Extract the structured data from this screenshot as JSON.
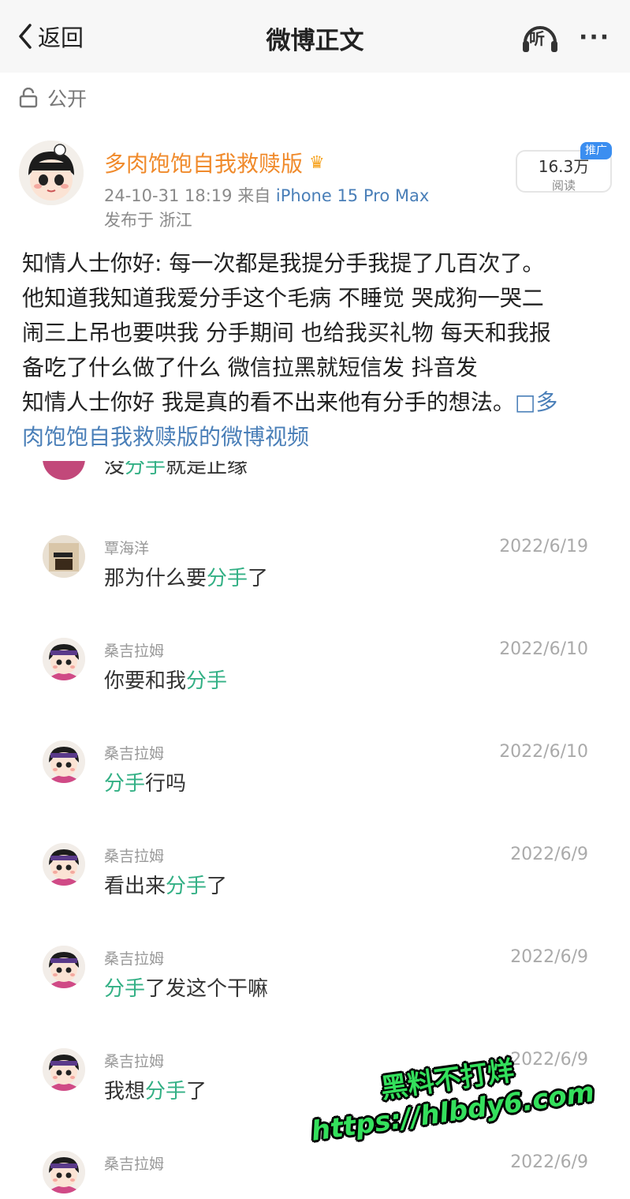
{
  "header": {
    "back_label": "返回",
    "title": "微博正文",
    "listen_label": "听",
    "more_label": "···"
  },
  "visibility": {
    "label": "公开"
  },
  "post": {
    "author": "多肉饱饱自我救赎版",
    "date": "24-10-31 18:19",
    "source_prefix": "来自",
    "device": "iPhone 15 Pro Max",
    "location": "发布于 浙江",
    "read_count": "16.3万",
    "read_label": "阅读",
    "promo_badge": "推广",
    "lines": [
      "知情人士你好: 每一次都是我提分手我提了几百次了。",
      "他知道我知道我爱分手这个毛病 不睡觉 哭成狗一哭二",
      "闹三上吊也要哄我 分手期间 也给我买礼物 每天和我报",
      "备吃了什么做了什么 微信拉黑就短信发 抖音发"
    ],
    "last_line": "知情人士你好 我是真的看不出来他有分手的想法。",
    "video_link_part1": "□多",
    "video_link_part2": "肉饱饱自我救赎版的微博视频"
  },
  "screenshot": {
    "partial_before": "没",
    "partial_keyword": "分手",
    "partial_after": "就是正缘",
    "comments": [
      {
        "name": "覃海洋",
        "date": "2022/6/19",
        "before": "那为什么要",
        "keyword": "分手",
        "after": "了"
      },
      {
        "name": "桑吉拉姆",
        "date": "2022/6/10",
        "before": "你要和我",
        "keyword": "分手",
        "after": ""
      },
      {
        "name": "桑吉拉姆",
        "date": "2022/6/10",
        "before": "",
        "keyword": "分手",
        "after": "行吗"
      },
      {
        "name": "桑吉拉姆",
        "date": "2022/6/9",
        "before": "看出来",
        "keyword": "分手",
        "after": "了"
      },
      {
        "name": "桑吉拉姆",
        "date": "2022/6/9",
        "before": "",
        "keyword": "分手",
        "after": "了发这个干嘛"
      },
      {
        "name": "桑吉拉姆",
        "date": "2022/6/9",
        "before": "我想",
        "keyword": "分手",
        "after": "了"
      },
      {
        "name": "桑吉拉姆",
        "date": "2022/6/9",
        "before": "",
        "keyword": "",
        "after": ""
      }
    ]
  },
  "watermark": {
    "line1": "黑料不打烊",
    "line2": "https://hlbdy6.com"
  },
  "colors": {
    "username": "#f08a2b",
    "link": "#4a7fb8",
    "keyword_highlight": "#33b085",
    "watermark": "#34e05c"
  }
}
